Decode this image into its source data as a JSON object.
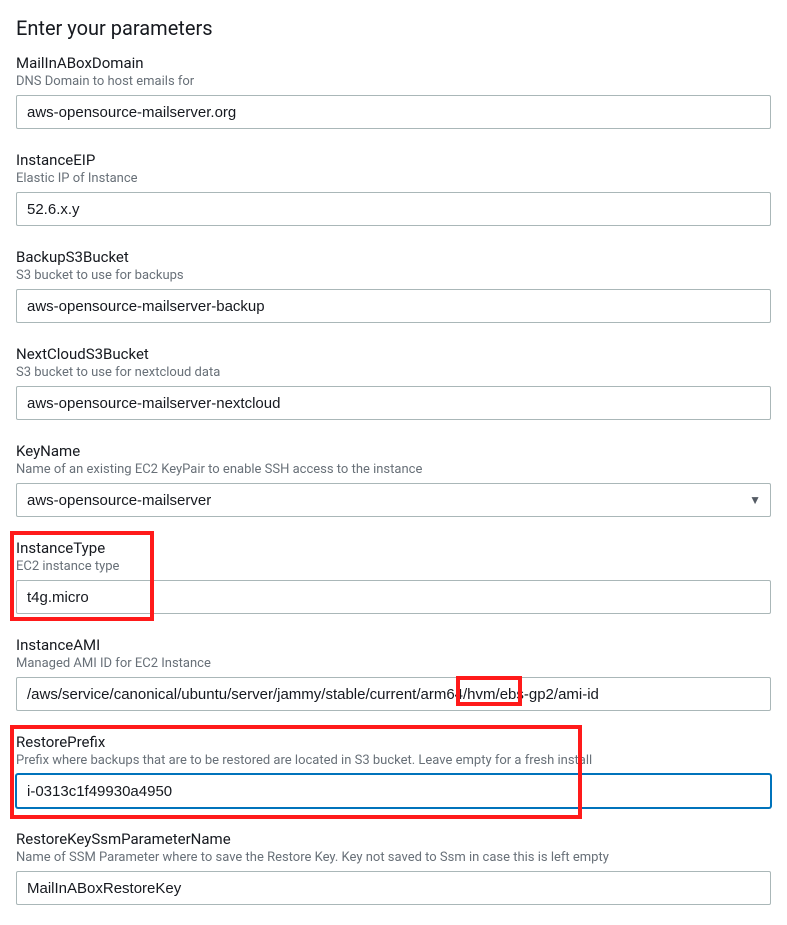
{
  "title": "Enter your parameters",
  "fields": {
    "mailinabox_domain": {
      "label": "MailInABoxDomain",
      "help": "DNS Domain to host emails for",
      "value": "aws-opensource-mailserver.org"
    },
    "instance_eip": {
      "label": "InstanceEIP",
      "help": "Elastic IP of Instance",
      "value": "52.6.x.y"
    },
    "backup_s3_bucket": {
      "label": "BackupS3Bucket",
      "help": "S3 bucket to use for backups",
      "value": "aws-opensource-mailserver-backup"
    },
    "nextcloud_s3_bucket": {
      "label": "NextCloudS3Bucket",
      "help": "S3 bucket to use for nextcloud data",
      "value": "aws-opensource-mailserver-nextcloud"
    },
    "key_name": {
      "label": "KeyName",
      "help": "Name of an existing EC2 KeyPair to enable SSH access to the instance",
      "value": "aws-opensource-mailserver"
    },
    "instance_type": {
      "label": "InstanceType",
      "help": "EC2 instance type",
      "value": "t4g.micro"
    },
    "instance_ami": {
      "label": "InstanceAMI",
      "help": "Managed AMI ID for EC2 Instance",
      "value": "/aws/service/canonical/ubuntu/server/jammy/stable/current/arm64/hvm/ebs-gp2/ami-id"
    },
    "restore_prefix": {
      "label": "RestorePrefix",
      "help": "Prefix where backups that are to be restored are located in S3 bucket. Leave empty for a fresh install",
      "value": "i-0313c1f49930a4950"
    },
    "restore_key_ssm": {
      "label": "RestoreKeySsmParameterName",
      "help": "Name of SSM Parameter where to save the Restore Key. Key not saved to Ssm in case this is left empty",
      "value": "MailInABoxRestoreKey"
    }
  }
}
